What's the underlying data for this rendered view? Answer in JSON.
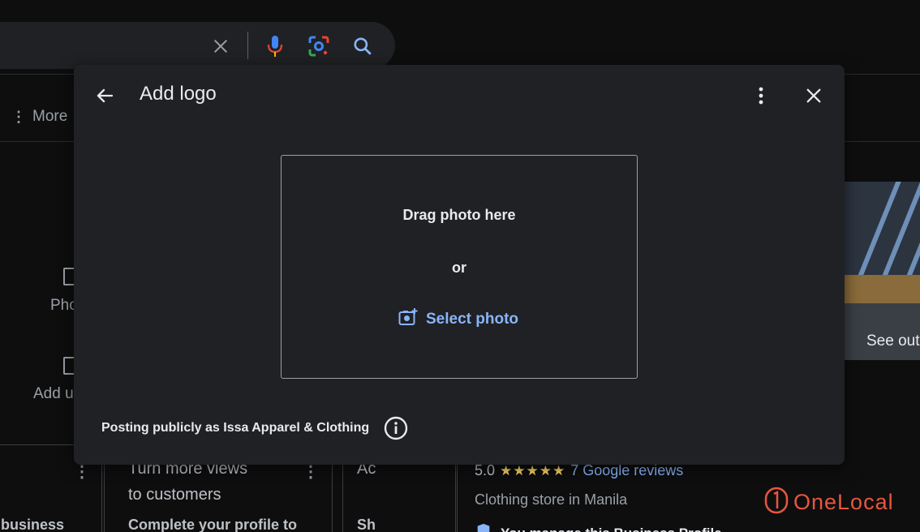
{
  "background": {
    "more_tab": "More",
    "left_panel": {
      "photos_label": "Pho",
      "add_update_label": "Add u"
    },
    "cards": [
      {
        "line1": "business"
      },
      {
        "line1": "Turn more views",
        "line2": "to customers",
        "sub": "Complete your profile to"
      },
      {
        "line1": "Ac",
        "sub": "Sh"
      }
    ],
    "map_caption": "See out",
    "rating": {
      "score": "5.0",
      "stars": "★★★★★",
      "reviews": "7 Google reviews"
    },
    "category": "Clothing store in Manila",
    "manage": "You manage this Business Profile",
    "brand": "OneLocal"
  },
  "dialog": {
    "title": "Add logo",
    "dropzone": {
      "drag_text": "Drag photo here",
      "or_text": "or",
      "select_label": "Select photo"
    },
    "posting_text": "Posting publicly as Issa Apparel & Clothing"
  },
  "colors": {
    "dialog_bg": "#202124",
    "accent_link": "#8ab4f8",
    "brand": "#e8563f",
    "star": "#fdd663"
  }
}
